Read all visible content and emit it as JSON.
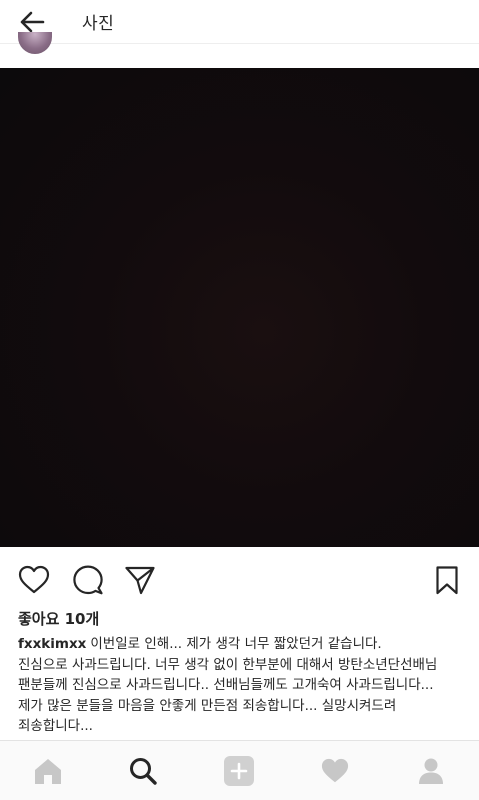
{
  "header": {
    "title": "사진"
  },
  "post": {
    "likes": "좋아요 10개",
    "username": "fxxkimxx",
    "caption_lines": [
      "이번일로 인해... 제가 생각 너무 짧았던거 같습니다.",
      "진심으로 사과드립니다. 너무 생각 없이 한부분에 대해서 방탄소년단선배님",
      "팬분들께 진심으로 사과드립니다.. 선배님들께도 고개숙여 사과드립니다...",
      "제가 많은 분들을 마음을 안좋게 만든점 죄송합니다... 실망시켜드려",
      "죄송합니다..."
    ]
  },
  "icons": {
    "back": "back-arrow-icon",
    "like": "heart-outline-icon",
    "comment": "comment-bubble-icon",
    "share": "paper-plane-icon",
    "save": "bookmark-icon",
    "nav": [
      "home-icon",
      "search-icon",
      "add-post-icon",
      "heart-icon",
      "profile-icon"
    ]
  },
  "colors": {
    "nav_active": "#262626",
    "nav_inactive": "#c7c7c7"
  }
}
